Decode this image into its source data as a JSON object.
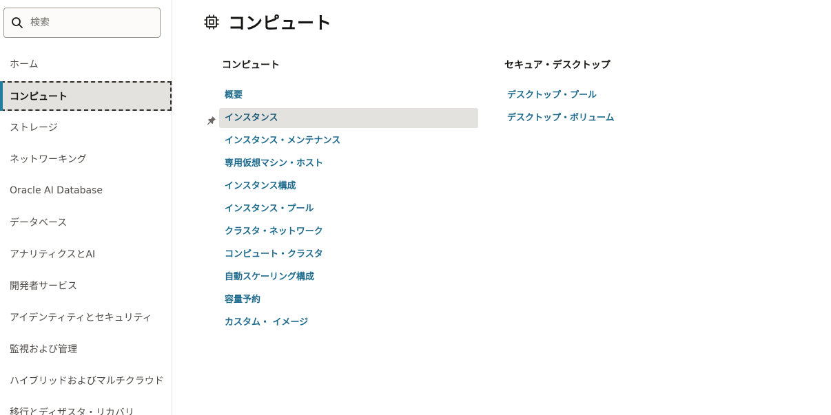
{
  "search": {
    "placeholder": "検索"
  },
  "sidebar": {
    "items": [
      {
        "label": "ホーム"
      },
      {
        "label": "コンピュート"
      },
      {
        "label": "ストレージ"
      },
      {
        "label": "ネットワーキング"
      },
      {
        "label": "Oracle AI Database"
      },
      {
        "label": "データベース"
      },
      {
        "label": "アナリティクスとAI"
      },
      {
        "label": "開発者サービス"
      },
      {
        "label": "アイデンティティとセキュリティ"
      },
      {
        "label": "監視および管理"
      },
      {
        "label": "ハイブリッドおよびマルチクラウド"
      },
      {
        "label": "移行とディザスタ・リカバリ"
      }
    ],
    "selected": "コンピュート"
  },
  "header": {
    "title": "コンピュート",
    "icon": "chip-icon"
  },
  "sections": [
    {
      "heading": "コンピュート",
      "links": [
        {
          "label": "概要"
        },
        {
          "label": "インスタンス"
        },
        {
          "label": "インスタンス・メンテナンス"
        },
        {
          "label": "専用仮想マシン・ホスト"
        },
        {
          "label": "インスタンス構成"
        },
        {
          "label": "インスタンス・プール"
        },
        {
          "label": "クラスタ・ネットワーク"
        },
        {
          "label": "コンピュート・クラスタ"
        },
        {
          "label": "自動スケーリング構成"
        },
        {
          "label": "容量予約"
        },
        {
          "label": "カスタム・ イメージ"
        }
      ]
    },
    {
      "heading": "セキュア・デスクトップ",
      "links": [
        {
          "label": "デスクトップ・プール"
        },
        {
          "label": "デスクトップ・ボリューム"
        }
      ]
    }
  ],
  "colors": {
    "accent": "#227e9e",
    "link": "#1d6a8c",
    "selected_bg": "#e4e2df"
  }
}
